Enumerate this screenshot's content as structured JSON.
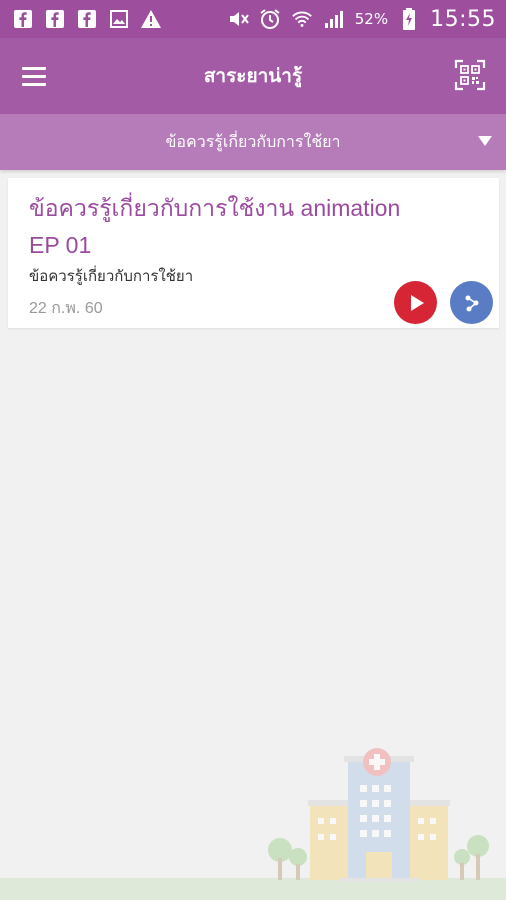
{
  "status_bar": {
    "battery_percent": "52%",
    "time": "15:55",
    "notification_icons": [
      "facebook-icon",
      "facebook-icon",
      "facebook-icon",
      "image-icon",
      "warning-icon"
    ],
    "system_icons": [
      "mute-icon",
      "alarm-icon",
      "wifi-icon",
      "signal-icon",
      "battery-charging-icon"
    ]
  },
  "app_bar": {
    "title": "สาระยาน่ารู้",
    "menu_icon": "hamburger-menu-icon",
    "qr_icon": "qr-scan-icon"
  },
  "category_dropdown": {
    "selected": "ข้อควรรู้เกี่ยวกับการใช้ยา"
  },
  "articles": [
    {
      "title": "ข้อควรรู้เกี่ยวกับการใช้งาน animation EP 01",
      "category": "ข้อควรรู้เกี่ยวกับการใช้ยา",
      "date": "22 ก.พ. 60",
      "play_icon": "play-icon",
      "share_icon": "share-icon"
    }
  ],
  "colors": {
    "status_bar": "#9d4f9d",
    "app_bar": "#a35ba6",
    "category_bar": "#b67cba",
    "title_text": "#9b4aa0",
    "play_button": "#d62535",
    "share_button": "#5a7cc4",
    "background": "#f1f1f1"
  }
}
